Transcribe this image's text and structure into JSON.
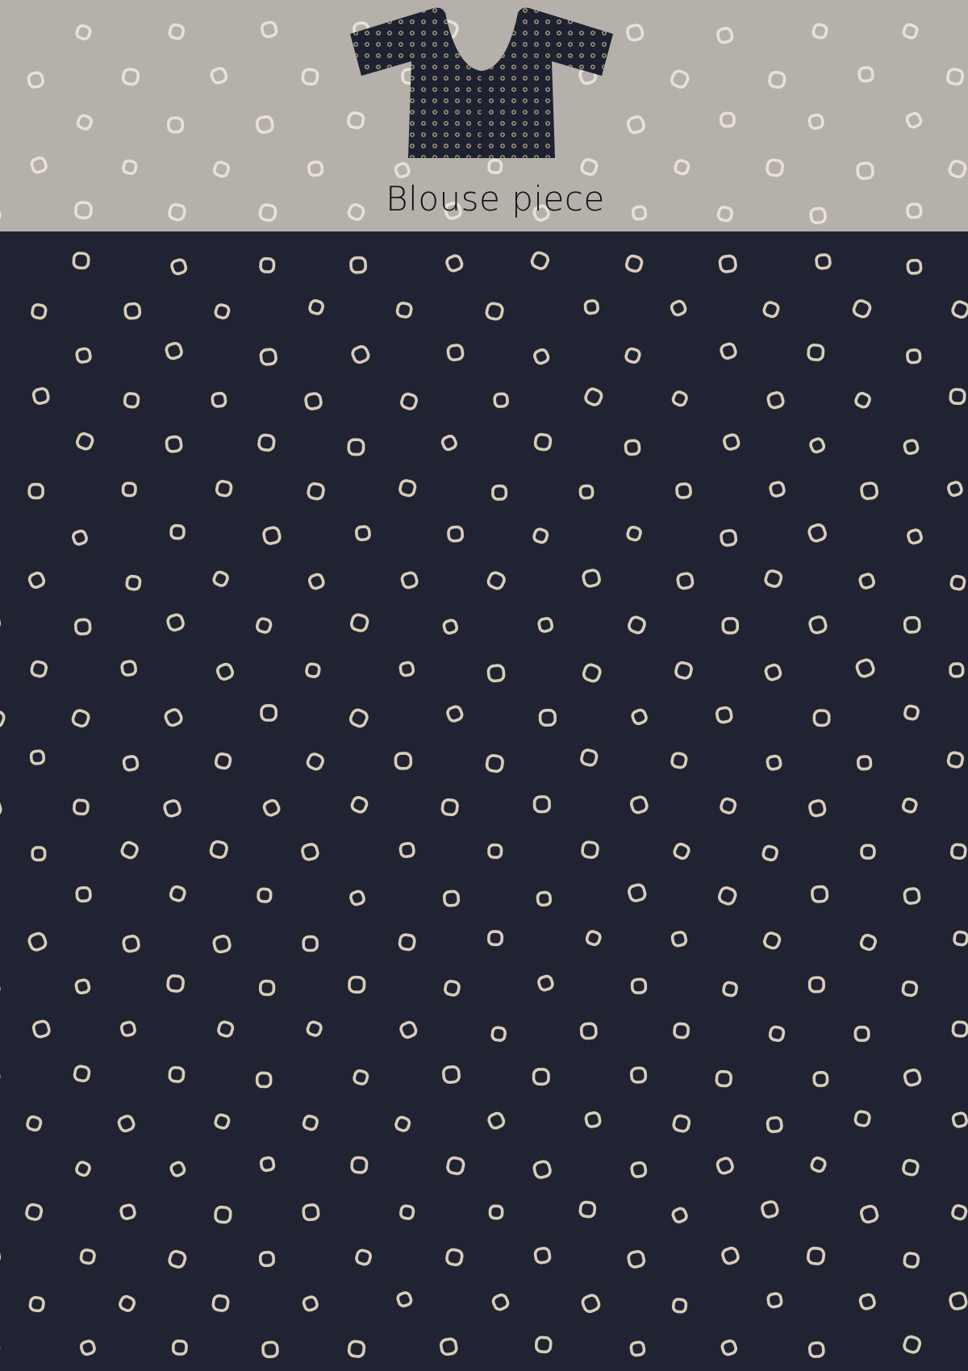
{
  "blouse_section": {
    "caption": "Blouse piece",
    "background_color": "#b6b0ab",
    "dot_color": "#e7e1d6",
    "icon": "blouse-icon",
    "icon_color": "#1e2130"
  },
  "saree_body": {
    "background_color": "#1f2231",
    "motif": "bandhani-dot",
    "dot_color": "#d9cdb8"
  }
}
